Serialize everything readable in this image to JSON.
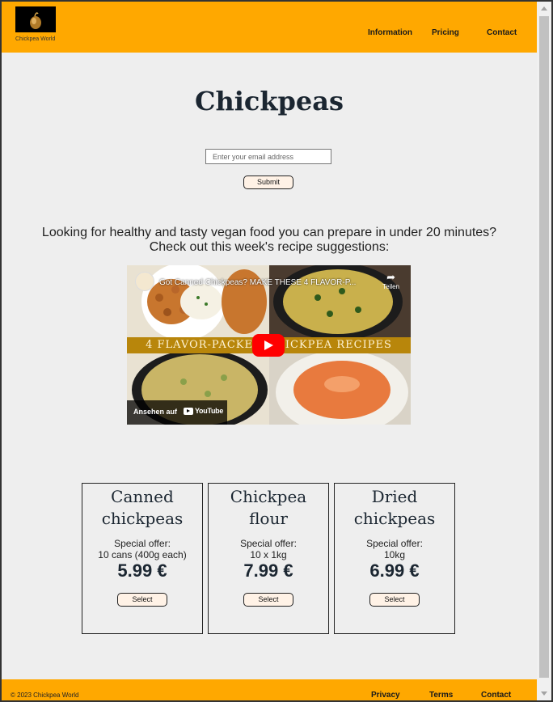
{
  "header": {
    "logo_caption": "Chickpea World",
    "nav": [
      "Information",
      "Pricing",
      "Contact"
    ]
  },
  "main": {
    "title": "Chickpeas",
    "email_placeholder": "Enter your email address",
    "submit_label": "Submit",
    "intro_line1": "Looking for healthy and tasty vegan food you can prepare in under 20 minutes?",
    "intro_line2": "Check out this week's recipe suggestions:"
  },
  "video": {
    "title": "Got Canned Chickpeas? MAKE THESE 4 FLAVOR-P...",
    "share_label": "Teilen",
    "banner": "4 FLAVOR-PACKED CHICKPEA RECIPES",
    "watch_on": "Ansehen auf",
    "platform": "YouTube"
  },
  "products": [
    {
      "name_line1": "Canned",
      "name_line2": "chickpeas",
      "offer_label": "Special offer:",
      "offer_detail": "10 cans (400g each)",
      "price": "5.99 €",
      "button": "Select"
    },
    {
      "name_line1": "Chickpea",
      "name_line2": "flour",
      "offer_label": "Special offer:",
      "offer_detail": "10 x 1kg",
      "price": "7.99 €",
      "button": "Select"
    },
    {
      "name_line1": "Dried",
      "name_line2": "chickpeas",
      "offer_label": "Special offer:",
      "offer_detail": "10kg",
      "price": "6.99 €",
      "button": "Select"
    }
  ],
  "footer": {
    "copyright": "© 2023 Chickpea World",
    "links": [
      "Privacy",
      "Terms",
      "Contact"
    ]
  },
  "colors": {
    "accent": "#ffa800",
    "background": "#eeeeee",
    "heading": "#1b2631"
  },
  "icons": [
    "chickpea-logo-icon",
    "share-icon",
    "play-icon",
    "youtube-icon"
  ]
}
